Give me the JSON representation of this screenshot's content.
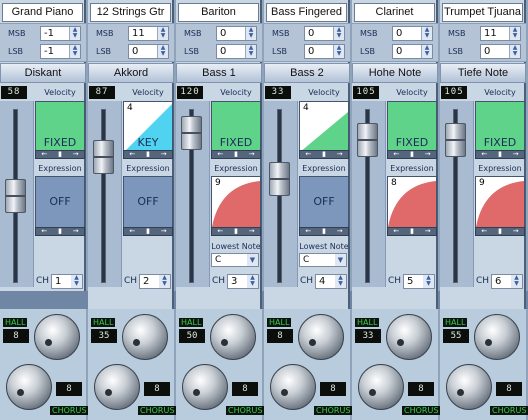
{
  "channels": [
    {
      "name": "Grand Piano",
      "msb": "-1",
      "lsb": "-1",
      "header": "Diskant",
      "level": "58",
      "velocity": {
        "label": "Velocity",
        "mode": "FIXED",
        "number": "",
        "color": "#5fd38a"
      },
      "expression": {
        "label": "Expression",
        "mode": "OFF",
        "number": "",
        "color": "#7d96bb"
      },
      "lowest_note": null,
      "ch_label": "CH",
      "ch": "1",
      "hall_label": "HALL",
      "hall": "8",
      "chorus": "8",
      "chorus_label": "CHORUS",
      "fader_level": 0.5
    },
    {
      "name": "12 Strings Gtr",
      "msb": "11",
      "lsb": "0",
      "header": "Akkord",
      "level": "87",
      "velocity": {
        "label": "Velocity",
        "mode": "KEY",
        "number": "4",
        "color": "#4fd3f0"
      },
      "expression": {
        "label": "Expression",
        "mode": "OFF",
        "number": "",
        "color": "#7d96bb"
      },
      "lowest_note": null,
      "ch_label": "CH",
      "ch": "2",
      "hall_label": "HALL",
      "hall": "35",
      "chorus": "8",
      "chorus_label": "CHORUS",
      "fader_level": 0.78
    },
    {
      "name": "Bariton",
      "msb": "0",
      "lsb": "0",
      "header": "Bass 1",
      "level": "120",
      "velocity": {
        "label": "Velocity",
        "mode": "FIXED",
        "number": "",
        "color": "#5fd38a"
      },
      "expression": {
        "label": "Expression",
        "mode": "",
        "number": "9",
        "color": "#e06a6a"
      },
      "lowest_note": {
        "label": "Lowest Note",
        "value": "C"
      },
      "ch_label": "CH",
      "ch": "3",
      "hall_label": "HALL",
      "hall": "50",
      "chorus": "8",
      "chorus_label": "CHORUS",
      "fader_level": 0.95
    },
    {
      "name": "Bass Fingered",
      "msb": "0",
      "lsb": "0",
      "header": "Bass 2",
      "level": "33",
      "velocity": {
        "label": "Velocity",
        "mode": "",
        "number": "4",
        "color": "#5fd38a"
      },
      "expression": {
        "label": "Expression",
        "mode": "OFF",
        "number": "",
        "color": "#7d96bb"
      },
      "lowest_note": {
        "label": "Lowest Note",
        "value": "C"
      },
      "ch_label": "CH",
      "ch": "4",
      "hall_label": "HALL",
      "hall": "8",
      "chorus": "8",
      "chorus_label": "CHORUS",
      "fader_level": 0.62
    },
    {
      "name": "Clarinet",
      "msb": "0",
      "lsb": "0",
      "header": "Hohe Note",
      "level": "105",
      "velocity": {
        "label": "Velocity",
        "mode": "FIXED",
        "number": "",
        "color": "#5fd38a"
      },
      "expression": {
        "label": "Expression",
        "mode": "",
        "number": "8",
        "color": "#e06a6a"
      },
      "lowest_note": null,
      "ch_label": "CH",
      "ch": "5",
      "hall_label": "HALL",
      "hall": "33",
      "chorus": "8",
      "chorus_label": "CHORUS",
      "fader_level": 0.9
    },
    {
      "name": "Trumpet Tjuana",
      "msb": "11",
      "lsb": "0",
      "header": "Tiefe Note",
      "level": "105",
      "velocity": {
        "label": "Velocity",
        "mode": "FIXED",
        "number": "",
        "color": "#5fd38a"
      },
      "expression": {
        "label": "Expression",
        "mode": "",
        "number": "9",
        "color": "#e06a6a"
      },
      "lowest_note": null,
      "ch_label": "CH",
      "ch": "6",
      "hall_label": "HALL",
      "hall": "55",
      "chorus": "8",
      "chorus_label": "CHORUS",
      "fader_level": 0.9
    }
  ],
  "labels": {
    "msb": "MSB",
    "lsb": "LSB"
  }
}
